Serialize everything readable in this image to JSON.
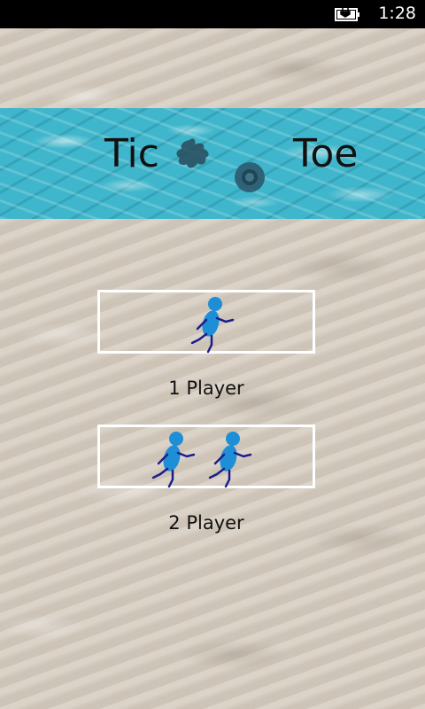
{
  "status_bar": {
    "time": "1:28",
    "battery_icon": "battery-charging-icon"
  },
  "banner": {
    "title_left": "Tic",
    "title_right": "Toe",
    "x_mark_icon": "splat-x-icon",
    "o_mark_icon": "ring-o-icon"
  },
  "menu": {
    "one_player": {
      "label": "1 Player",
      "icon": "single-runner-icon"
    },
    "two_player": {
      "label": "2 Player",
      "icon": "two-runners-icon"
    }
  },
  "colors": {
    "runner_body": "#1e8fd6",
    "runner_limbs": "#1d1d8a",
    "button_border": "#ffffff",
    "water": "#3fb6cb",
    "sand": "#d6cdc1"
  }
}
